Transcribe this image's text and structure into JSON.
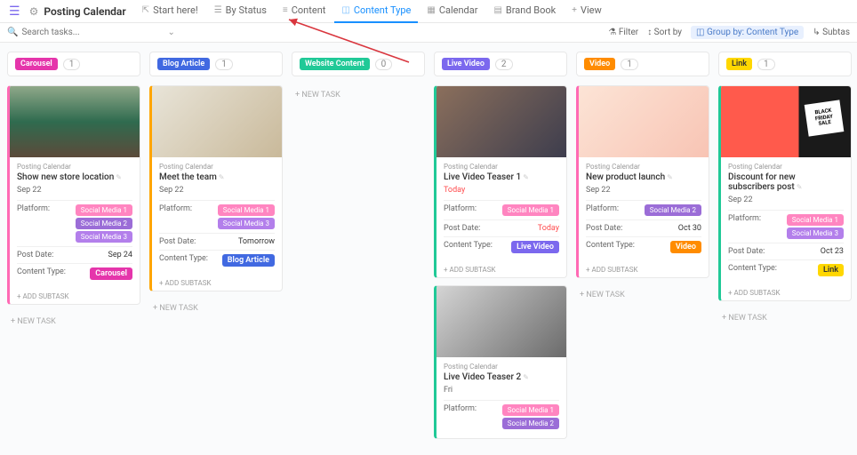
{
  "header": {
    "title": "Posting Calendar",
    "tabs": [
      {
        "icon": "⇱",
        "label": "Start here!"
      },
      {
        "icon": "☰",
        "label": "By Status"
      },
      {
        "icon": "≡",
        "label": "Content"
      },
      {
        "icon": "◫",
        "label": "Content Type"
      },
      {
        "icon": "▦",
        "label": "Calendar"
      },
      {
        "icon": "▤",
        "label": "Brand Book"
      },
      {
        "icon": "+",
        "label": "View"
      }
    ]
  },
  "search": {
    "placeholder": "Search tasks...",
    "filter": "Filter",
    "sort": "Sort by",
    "group": "Group by: Content Type",
    "subtask": "Subtas"
  },
  "newtask": "+ NEW TASK",
  "addsubtask": "+ ADD SUBTASK",
  "columns": [
    {
      "name": "Carousel",
      "count": "1",
      "tagClass": "tag-carousel"
    },
    {
      "name": "Blog Article",
      "count": "1",
      "tagClass": "tag-blog"
    },
    {
      "name": "Website Content",
      "count": "0",
      "tagClass": "tag-website"
    },
    {
      "name": "Live Video",
      "count": "2",
      "tagClass": "tag-livevideo"
    },
    {
      "name": "Video",
      "count": "1",
      "tagClass": "tag-video"
    },
    {
      "name": "Link",
      "count": "1",
      "tagClass": "tag-link"
    }
  ],
  "labels": {
    "platform": "Platform:",
    "postdate": "Post Date:",
    "contenttype": "Content Type:",
    "crumb": "Posting Calendar"
  },
  "cards": {
    "c0": {
      "title": "Show new store location",
      "date": "Sep 22",
      "platforms": [
        "Social Media 1",
        "Social Media 2",
        "Social Media 3"
      ],
      "postdate": "Sep 24",
      "contenttype": "Carousel",
      "ctClass": "tag-carousel"
    },
    "c1": {
      "title": "Meet the team",
      "date": "Sep 22",
      "platforms": [
        "Social Media 1",
        "Social Media 3"
      ],
      "postdate": "Tomorrow",
      "contenttype": "Blog Article",
      "ctClass": "tag-blog"
    },
    "c3a": {
      "title": "Live Video Teaser 1",
      "date": "Today",
      "platforms": [
        "Social Media 1"
      ],
      "postdate": "Today",
      "contenttype": "Live Video",
      "ctClass": "tag-livevideo"
    },
    "c3b": {
      "title": "Live Video Teaser 2",
      "date": "Fri",
      "platforms": [
        "Social Media 1",
        "Social Media 2"
      ]
    },
    "c4": {
      "title": "New product launch",
      "date": "Sep 22",
      "platforms": [
        "Social Media 2"
      ],
      "postdate": "Oct 30",
      "contenttype": "Video",
      "ctClass": "tag-video"
    },
    "c5": {
      "title": "Discount for new subscribers post",
      "date": "Sep 22",
      "platforms": [
        "Social Media 1",
        "Social Media 3"
      ],
      "postdate": "Oct 23",
      "contenttype": "Link",
      "ctClass": "tag-link"
    }
  }
}
